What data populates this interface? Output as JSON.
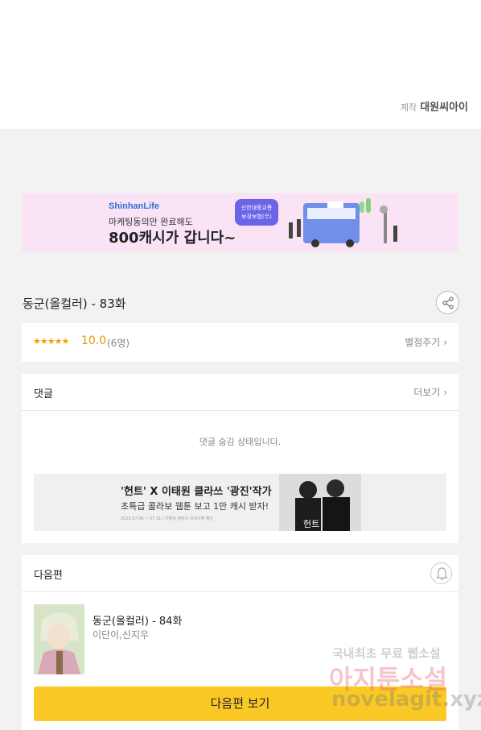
{
  "credit": {
    "label": "제작",
    "name": "대원씨아이"
  },
  "ad": {
    "brand": "ShinhanLife",
    "line1": "마케팅동의만 완료해도",
    "line2": "800캐시가 갑니다~",
    "badge_line1": "신한대중교통",
    "badge_line2": "보장보험(무)"
  },
  "episode": {
    "title": "동군(올컬러) - 83화"
  },
  "rating": {
    "stars": "★★★★★",
    "score": "10.0",
    "voters": "(6명)",
    "rate_link": "별점주기"
  },
  "comments": {
    "title": "댓글",
    "more": "더보기",
    "hidden_message": "댓글 숨김 상태입니다.",
    "promo_title": "'헌트' X 이태원 클라쓰 '광진'작가",
    "promo_sub": "초특급 콜라보 웹툰 보고 1만 캐시 받자!",
    "promo_fine": "2022.07.06 ~ 07.31 | 이벤트 참여시 유의사항 확인",
    "promo_logo": "헌트"
  },
  "next": {
    "title": "다음편",
    "episode_title": "동군(올컬러) - 84화",
    "authors": "이단이,신지우",
    "button_label": "다음편 보기"
  },
  "watermark": {
    "line1": "국내최초 무료 웹소설",
    "line2": "아지툰소설",
    "line3": "novelagit.xyz"
  },
  "icons": {
    "share": "share-icon",
    "bell": "bell-icon",
    "chevron": "chevron-right-icon"
  },
  "colors": {
    "accent": "#fbc925",
    "star": "#f2a300",
    "ad_bg": "#fbe3f6"
  }
}
